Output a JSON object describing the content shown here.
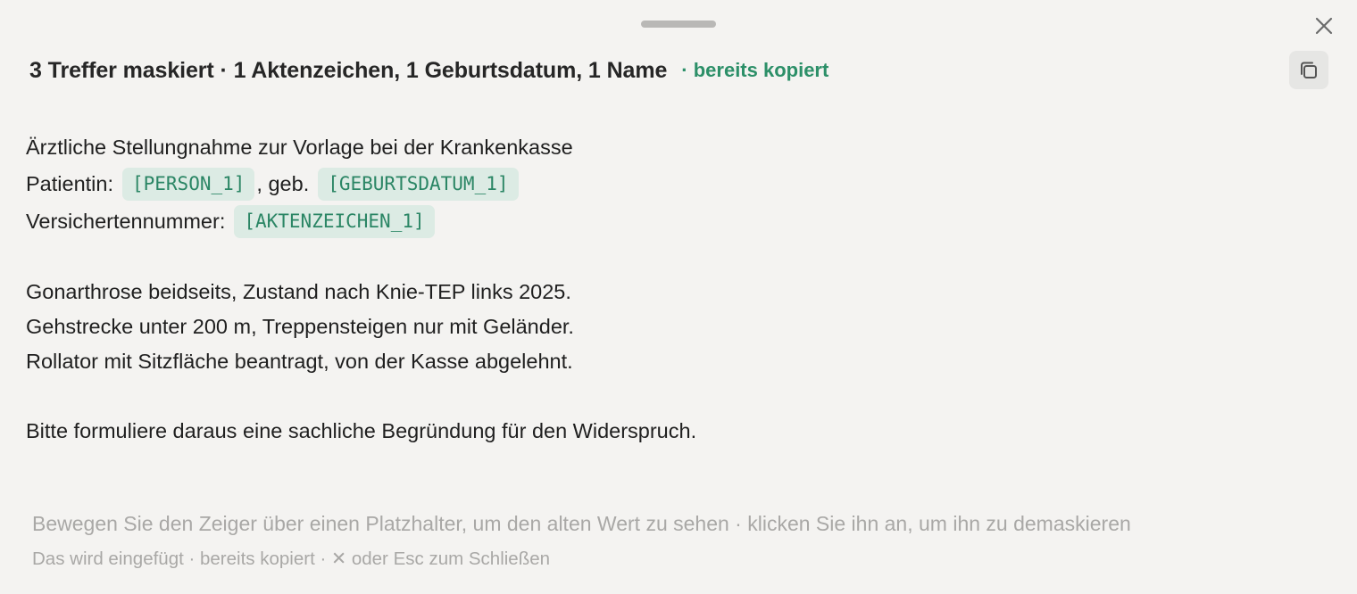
{
  "header": {
    "title": "3 Treffer maskiert · 1 Aktenzeichen, 1 Geburtsdatum, 1 Name",
    "status": "· bereits kopiert"
  },
  "content": {
    "line1": "Ärztliche Stellungnahme zur Vorlage bei der Krankenkasse",
    "line2": {
      "prefix": "Patientin:",
      "placeholder_person": "[PERSON_1]",
      "middle": ", geb.",
      "placeholder_birthdate": "[GEBURTSDATUM_1]"
    },
    "line3": {
      "prefix": "Versichertennummer:",
      "placeholder_case": "[AKTENZEICHEN_1]"
    },
    "line5": "Gonarthrose beidseits, Zustand nach Knie-TEP links 2025.",
    "line6": "Gehstrecke unter 200 m, Treppensteigen nur mit Geländer.",
    "line7": "Rollator mit Sitzfläche beantragt, von der Kasse abgelehnt.",
    "line9": "Bitte formuliere daraus eine sachliche Begründung für den Widerspruch."
  },
  "footer": {
    "hint": "Bewegen Sie den Zeiger über einen Platzhalter, um den alten Wert zu sehen · klicken Sie ihn an, um ihn zu demaskieren",
    "keys": "Das wird eingefügt · bereits kopiert · ✕ oder Esc zum Schließen"
  },
  "icons": {
    "close": "close-icon",
    "copy": "copy-icon",
    "drag": "drag-handle"
  },
  "colors": {
    "accent": "#2c8f68",
    "chip_bg": "#dcebe4",
    "background": "#f4f3f1"
  }
}
